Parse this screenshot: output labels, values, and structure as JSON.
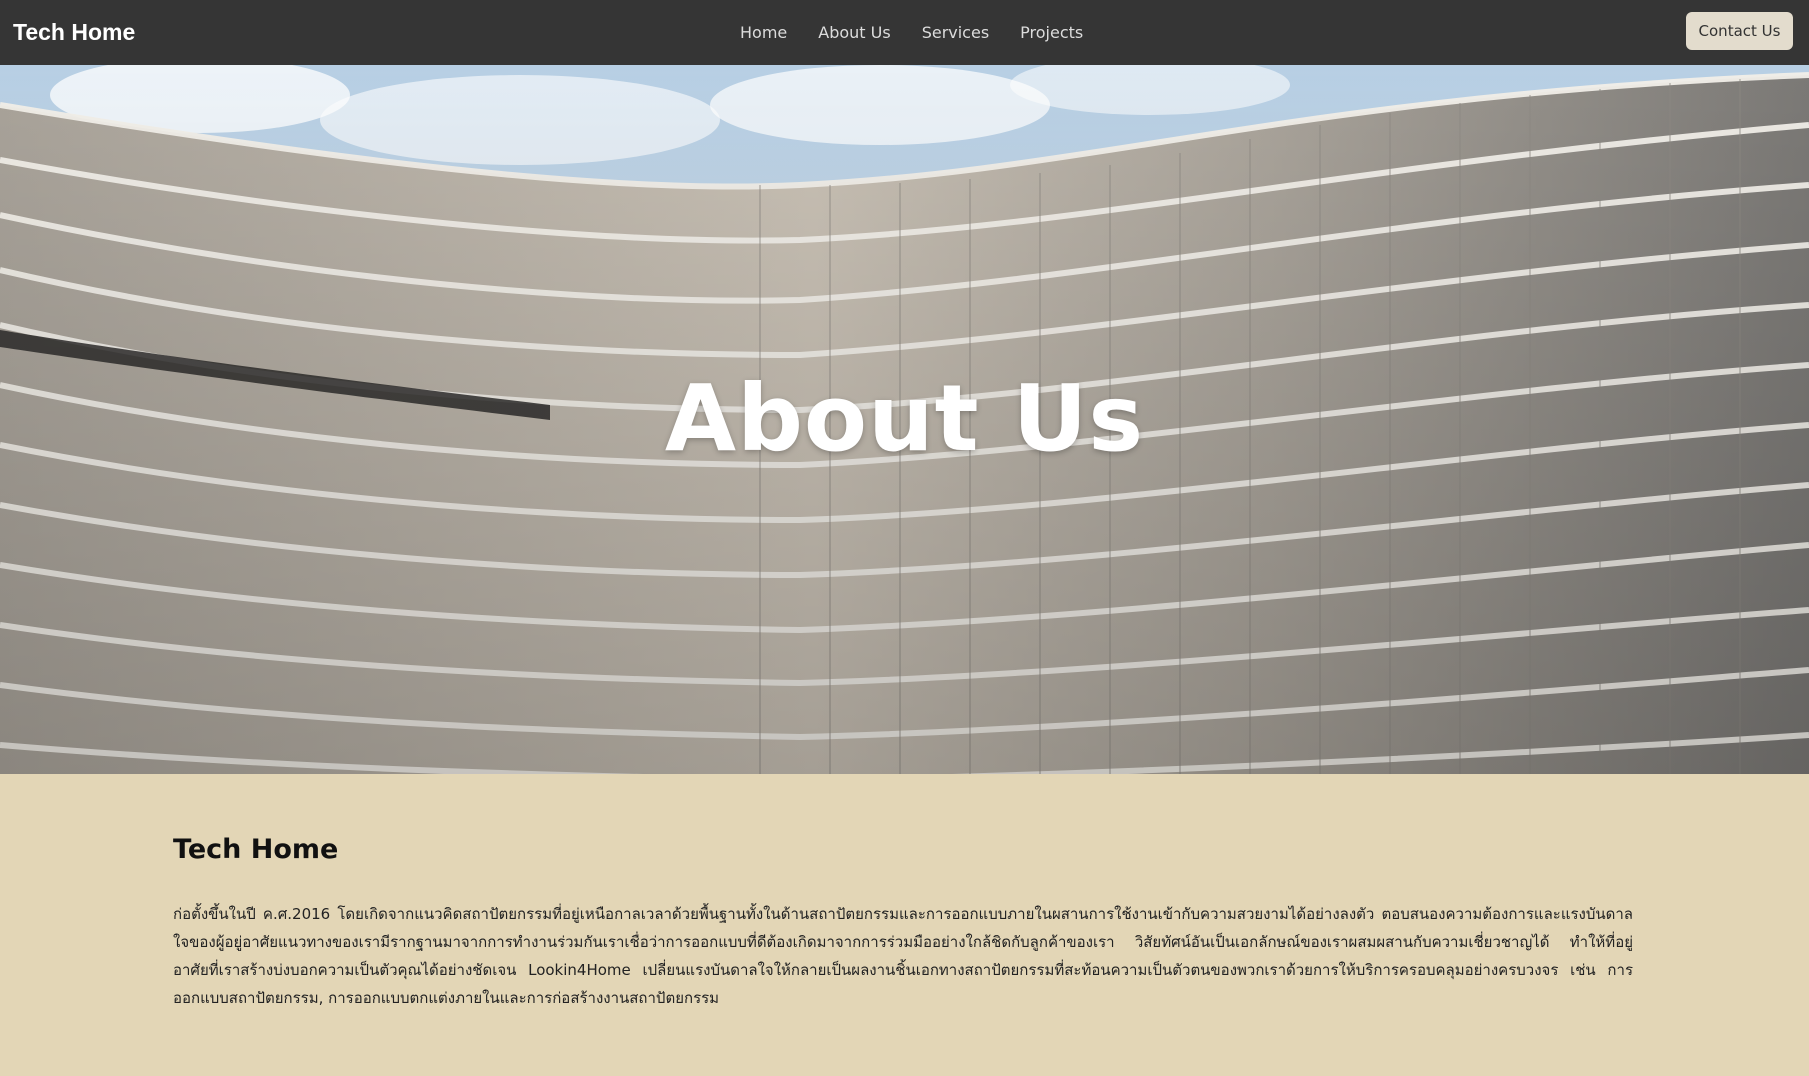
{
  "header": {
    "brand": "Tech Home",
    "nav": [
      {
        "label": "Home"
      },
      {
        "label": "About Us"
      },
      {
        "label": "Services"
      },
      {
        "label": "Projects"
      }
    ],
    "contact_label": "Contact Us"
  },
  "hero": {
    "title": "About Us"
  },
  "about": {
    "company_name": "Tech Home",
    "description": "ก่อตั้งขึ้นในปี ค.ศ.2016 โดยเกิดจากแนวคิดสถาปัตยกรรมที่อยู่เหนือกาลเวลาด้วยพื้นฐานทั้งในด้านสถาปัตยกรรมและการออกแบบภายในผสานการใช้งานเข้ากับความสวยงามได้อย่างลงตัว ตอบสนองความต้องการและแรงบันดาลใจของผู้อยู่อาศัยแนวทางของเรามีรากฐานมาจากการทำงานร่วมกันเราเชื่อว่าการออกแบบที่ดีต้องเกิดมาจากการร่วมมืออย่างใกล้ชิดกับลูกค้าของเรา วิสัยทัศน์อันเป็นเอกลักษณ์ของเราผสมผสานกับความเชี่ยวชาญได้ ทำให้ที่อยู่อาศัยที่เราสร้างบ่งบอกความเป็นตัวคุณได้อย่างชัดเจน Lookin4Home เปลี่ยนแรงบันดาลใจให้กลายเป็นผลงานชิ้นเอกทางสถาปัตยกรรมที่สะท้อนความเป็นตัวตนของพวกเราด้วยการให้บริการครอบคลุมอย่างครบวงจร เช่น การออกแบบสถาปัตยกรรม, การออกแบบตกแต่งภายในและการก่อสร้างงานสถาปัตยกรรม"
  },
  "colors": {
    "navbar": "#353535",
    "content_bg": "#e3d6b6",
    "contact_button_bg": "#e3dccd"
  }
}
